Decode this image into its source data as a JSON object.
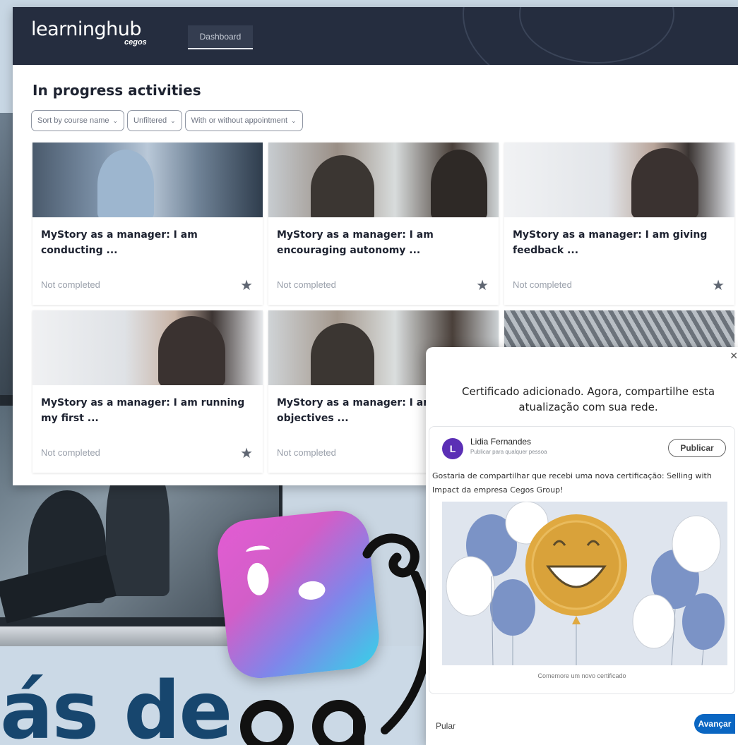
{
  "colors": {
    "header_bg": "#252d3f",
    "headline_blue": "#17466e",
    "linkedin_blue": "#0a66c2",
    "avatar_purple": "#5b2fb5"
  },
  "learninghub": {
    "logo": "learninghub",
    "logo_sub": "cegos",
    "nav_tab": "Dashboard",
    "page_title": "In progress activities",
    "filters": [
      {
        "label": "Sort by course name",
        "icon": "chevron-down-icon"
      },
      {
        "label": "Unfiltered",
        "icon": "chevron-down-icon"
      },
      {
        "label": "With or without appointment",
        "icon": "chevron-down-icon"
      }
    ],
    "cards": [
      {
        "title": "MyStory as a manager: I am conducting ...",
        "status": "Not completed",
        "icon": "star-icon"
      },
      {
        "title": "MyStory as a manager: I am encouraging autonomy ...",
        "status": "Not completed",
        "icon": "star-icon"
      },
      {
        "title": "MyStory as a manager: I am giving feedback ...",
        "status": "Not completed",
        "icon": "star-icon"
      },
      {
        "title": "MyStory as a manager: I am running my first ...",
        "status": "Not completed",
        "icon": "star-icon"
      },
      {
        "title": "MyStory as a manager: I am objectives ...",
        "status": "Not completed",
        "icon": "star-icon"
      },
      {
        "title": "",
        "status": "",
        "icon": ""
      }
    ]
  },
  "modal": {
    "title": "Certificado adicionado. Agora, compartilhe esta atualização com sua rede.",
    "avatar_letter": "L",
    "author": "Lidia Fernandes",
    "audience": "Publicar para qualquer pessoa",
    "publish_label": "Publicar",
    "post_text": "Gostaria de compartilhar que recebi uma nova certificação: Selling with Impact da empresa Cegos Group!",
    "illustration_caption": "Comemore um novo certificado",
    "skip_label": "Pular",
    "next_label": "Avançar",
    "close_icon": "close-icon"
  },
  "background": {
    "headline": "ás de"
  }
}
